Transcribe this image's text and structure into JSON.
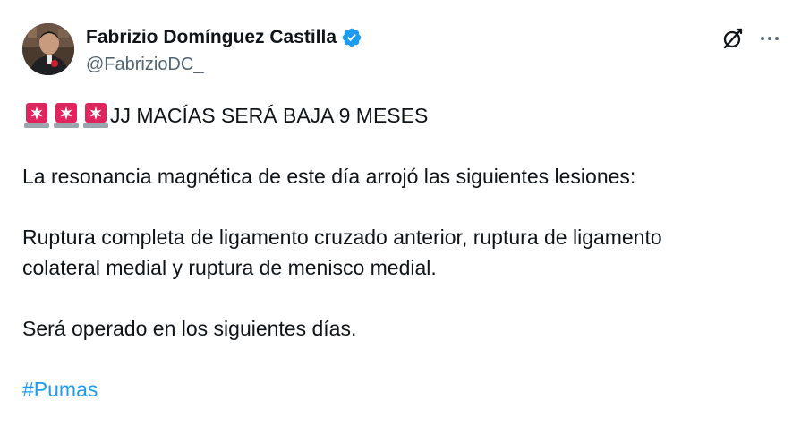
{
  "author": {
    "name": "Fabrizio Domínguez Castilla",
    "handle": "@FabrizioDC_",
    "verified": true,
    "avatar_icon": "profile-photo"
  },
  "header_actions": {
    "grok_icon": "grok-icon",
    "more_icon": "more-options-icon"
  },
  "tweet": {
    "headline_emoji": "police-light-icon",
    "headline_emoji_count": 3,
    "headline": "JJ MACÍAS SERÁ BAJA 9 MESES",
    "paragraph1": "La resonancia magnética de este día arrojó las siguientes lesiones:",
    "paragraph2_line1": "Ruptura completa de ligamento cruzado anterior, ruptura de ligamento",
    "paragraph2_line2": "colateral medial y ruptura de menisco medial.",
    "paragraph3": "Será operado en los siguientes días.",
    "hashtag": "#Pumas"
  },
  "colors": {
    "text": "#0f1419",
    "secondary": "#536471",
    "accent": "#1d9bf0",
    "siren_red": "#e0245e"
  }
}
